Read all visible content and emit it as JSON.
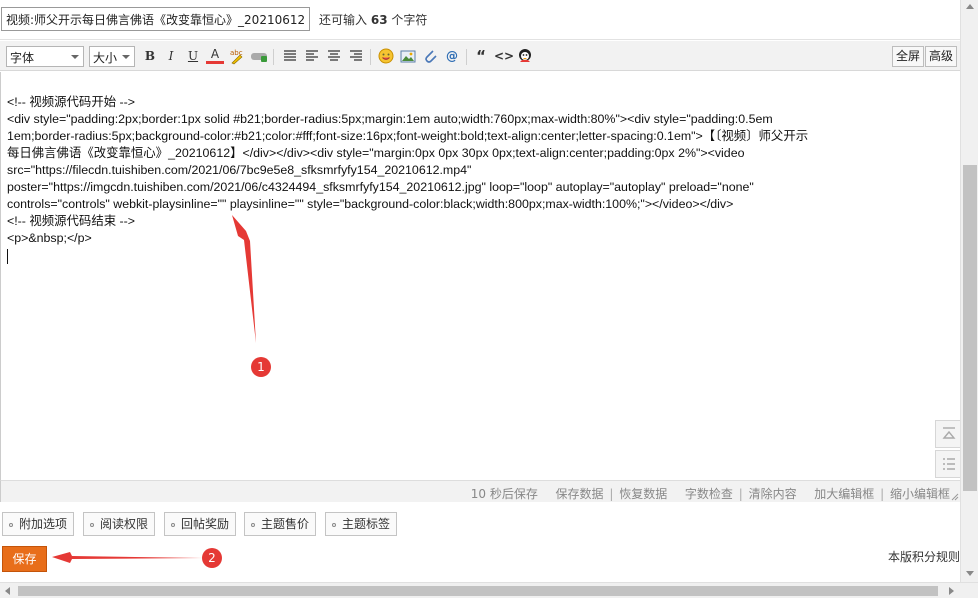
{
  "title_input": {
    "value": "视频:师父开示每日佛言佛语《改变靠恒心》_20210612"
  },
  "char_counter": {
    "prefix": "还可输入",
    "count": "63",
    "suffix": "个字符"
  },
  "toolbar": {
    "font_select": "字体",
    "size_select": "大小",
    "bold": "B",
    "italic": "I",
    "underline": "U",
    "font_color": "A",
    "quote_icon": "“",
    "code_icon": "<>",
    "fullscreen": "全屏",
    "advanced": "高级"
  },
  "editor": {
    "lines": [
      "<!-- 视频源代码开始 -->",
      "<div style=\"padding:2px;border:1px solid #b21;border-radius:5px;margin:1em auto;width:760px;max-width:80%\"><div style=\"padding:0.5em",
      "1em;border-radius:5px;background-color:#b21;color:#fff;font-size:16px;font-weight:bold;text-align:center;letter-spacing:0.1em\">【〔视频〕师父开示",
      "每日佛言佛语《改变靠恒心》_20210612】</div></div><div style=\"margin:0px 0px 30px 0px;text-align:center;padding:0px 2%\"><video",
      "src=\"https://filecdn.tuishiben.com/2021/06/7bc9e5e8_sfksmrfyfy154_20210612.mp4\"",
      "poster=\"https://imgcdn.tuishiben.com/2021/06/c4324494_sfksmrfyfy154_20210612.jpg\" loop=\"loop\" autoplay=\"autoplay\" preload=\"none\"",
      "controls=\"controls\" webkit-playsinline=\"\" playsinline=\"\" style=\"background-color:black;width:800px;max-width:100%;\"></video></div>",
      "<!-- 视频源代码结束 -->",
      "<p>&nbsp;</p>"
    ]
  },
  "status_bar": {
    "autosave": "10 秒后保存",
    "save_data": "保存数据",
    "restore_data": "恢复数据",
    "word_check": "字数检查",
    "clear_content": "清除内容",
    "enlarge_editor": "加大编辑框",
    "shrink_editor": "缩小编辑框"
  },
  "options": [
    "附加选项",
    "阅读权限",
    "回帖奖励",
    "主题售价",
    "主题标签"
  ],
  "save_button": "保存",
  "rules_link": "本版积分规则",
  "annotations": {
    "badge_1": "1",
    "badge_2": "2"
  },
  "colors": {
    "save_orange": "#e86e1a",
    "annotation_red": "#e53935"
  }
}
